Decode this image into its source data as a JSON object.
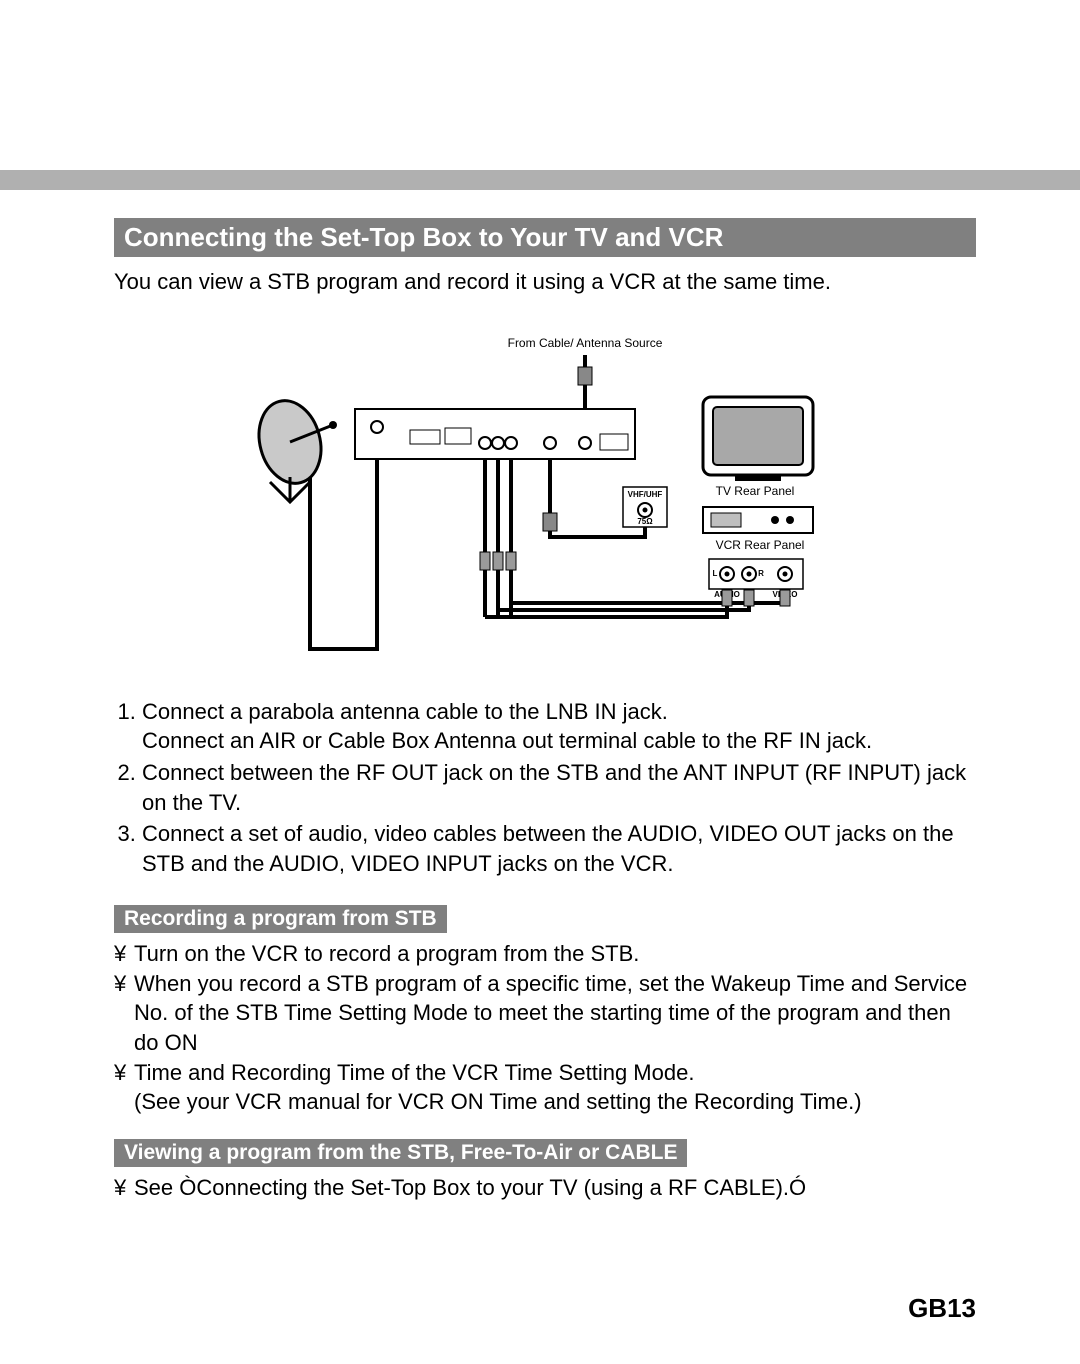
{
  "section_title": "Connecting the Set-Top Box to Your TV and VCR",
  "intro": "You can view a STB program and record it using a VCR at the same time.",
  "diagram": {
    "from_source": "From Cable/ Antenna Source",
    "tv_rear": "TV Rear Panel",
    "vcr_rear": "VCR Rear Panel",
    "vhf_uhf": "VHF/UHF",
    "seventyfive": "75Ω",
    "l": "L",
    "r": "R",
    "audio": "AUDIO",
    "video": "VIDEO"
  },
  "steps": [
    "Connect a parabola antenna cable to the LNB IN jack.\nConnect an AIR or Cable Box Antenna out terminal cable to the RF IN jack.",
    "Connect between the RF OUT jack on the STB and the ANT INPUT (RF INPUT) jack on the TV.",
    "Connect a set of audio, video cables between the AUDIO, VIDEO OUT jacks on the STB and the AUDIO, VIDEO INPUT jacks on the VCR."
  ],
  "sub1_title": "Recording a program from STB",
  "sub1_bullets": [
    "Turn on the VCR to record a program from the STB.",
    "When you record a STB program of a specific time, set the Wakeup Time and Service No. of the STB Time Setting Mode to meet the starting time of the program and then do ON",
    "Time and Recording Time of the VCR Time Setting Mode.\n(See your VCR manual for VCR ON Time and setting the Recording Time.)"
  ],
  "sub2_title": "Viewing a program from the STB, Free-To-Air or CABLE",
  "sub2_bullets": [
    "See ÒConnecting the Set-Top Box to your TV (using a RF CABLE).Ó"
  ],
  "bullet_mark": "¥",
  "page_number": "GB13"
}
